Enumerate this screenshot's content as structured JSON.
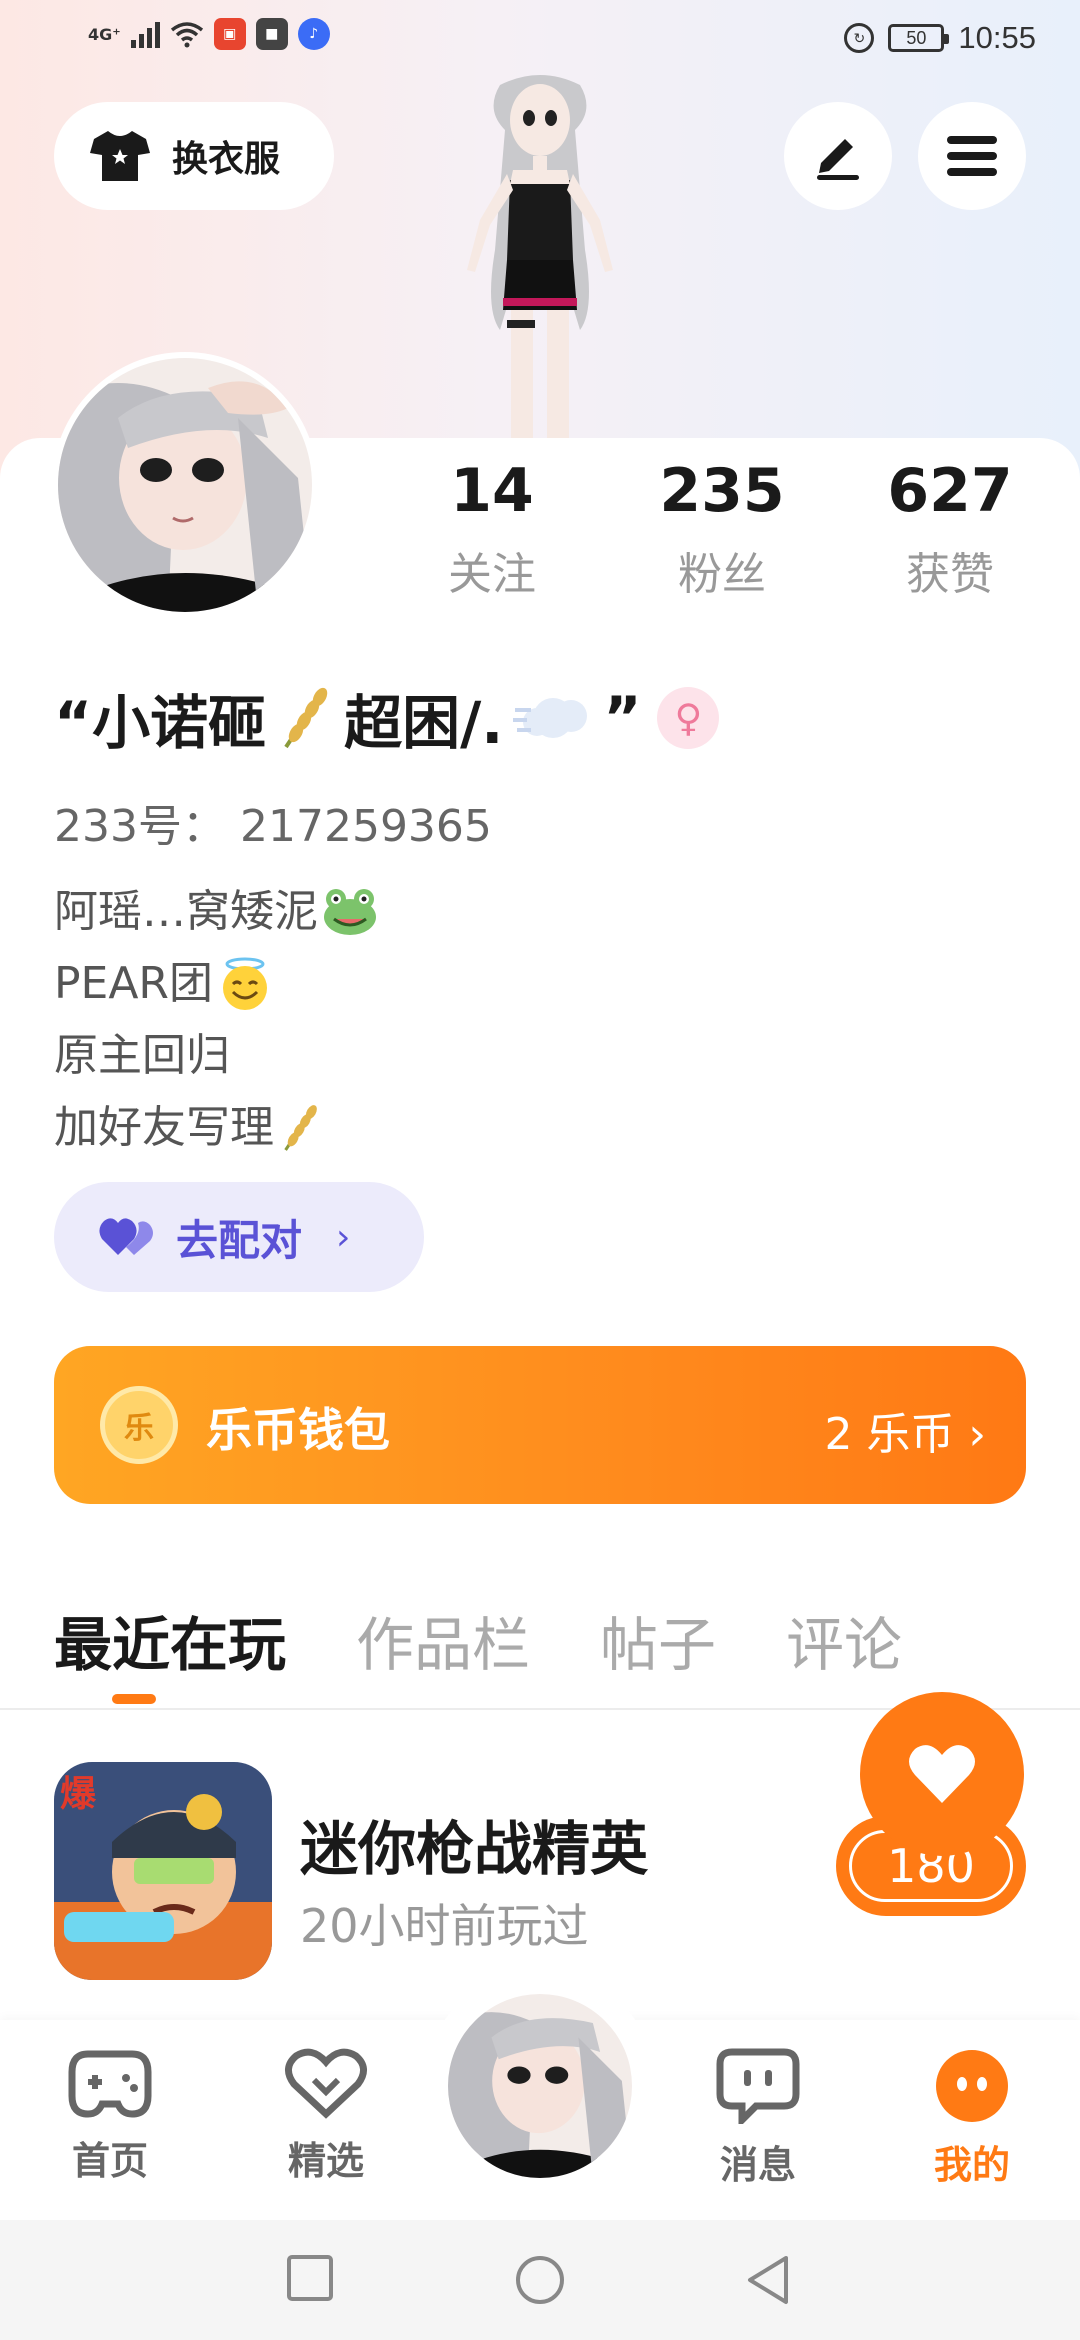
{
  "status_bar": {
    "network": "4G⁺",
    "battery": "50",
    "time": "10:55"
  },
  "header": {
    "dress_button_label": "换衣服",
    "edit_icon": "pen-icon",
    "menu_icon": "menu-icon"
  },
  "profile": {
    "stats": [
      {
        "value": "14",
        "label": "关注"
      },
      {
        "value": "235",
        "label": "粉丝"
      },
      {
        "value": "627",
        "label": "获赞"
      }
    ],
    "nickname_part1": "“小诺砸",
    "nickname_part2": "超困/.",
    "nickname_part3": "”",
    "gender_symbol": "♀",
    "uid": "233号：  217259365",
    "bio": [
      "阿瑶…窝矮泥",
      "PEAR团",
      "原主回归",
      "加好友写理"
    ],
    "match_button_label": "去配对",
    "match_chevron": "›"
  },
  "wallet": {
    "coin_char": "乐",
    "title": "乐币钱包",
    "amount": "2 乐币 ›"
  },
  "tabs": [
    "最近在玩",
    "作品栏",
    "帖子",
    "评论"
  ],
  "recent_game": {
    "title": "迷你枪战精英",
    "subtitle": "20小时前玩过",
    "icon_badge": "爆"
  },
  "like_float": {
    "count": "180"
  },
  "bottom_nav": {
    "items": [
      {
        "label": "首页"
      },
      {
        "label": "精选"
      },
      {
        "label": "消息"
      },
      {
        "label": "我的"
      }
    ]
  },
  "colors": {
    "accent": "#ff7a14",
    "match_purple": "#5a52d6",
    "wallet_gradient_start": "#ffa623",
    "wallet_gradient_end": "#ff7914"
  }
}
